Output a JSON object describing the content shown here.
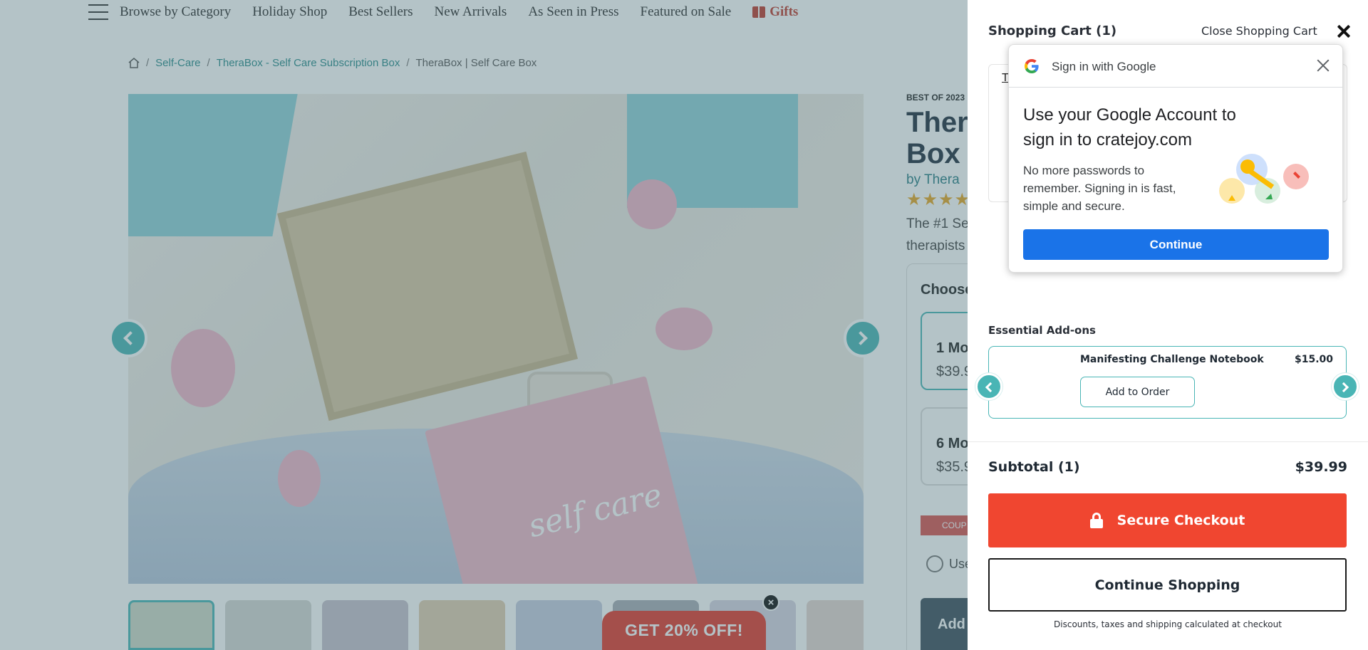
{
  "nav": {
    "items": [
      "Browse by Category",
      "Holiday Shop",
      "Best Sellers",
      "New Arrivals",
      "As Seen in Press",
      "Featured on Sale"
    ],
    "gifts": "Gifts"
  },
  "breadcrumb": {
    "items": [
      "Self-Care",
      "TheraBox - Self Care Subscription Box"
    ],
    "current": "TheraBox | Self Care Box"
  },
  "hero": {
    "book_text": "self care"
  },
  "product": {
    "badge": "BEST OF 2023",
    "title_line1": "Thera",
    "title_line2": "Box",
    "byline": "by Thera",
    "rating_stars": "★★★★★",
    "description_line1": "The #1 Se",
    "description_line2": "therapists",
    "choose_label": "Choose",
    "plans": [
      {
        "name": "1 Mo",
        "price": "$39.9"
      },
      {
        "name": "6 Mo",
        "price": "$35.9"
      }
    ],
    "coupon_label": "COUP",
    "use_label": "Use",
    "add_label": "Add"
  },
  "promo": {
    "label": "GET 20% OFF!",
    "close": "×"
  },
  "cart": {
    "title": "Shopping Cart (1)",
    "close_label": "Close Shopping Cart",
    "item_peek": "T",
    "addons_title": "Essential Add-ons",
    "addon": {
      "name": "Manifesting Challenge Notebook",
      "price": "$15.00",
      "button": "Add to Order"
    },
    "subtotal_label": "Subtotal (1)",
    "subtotal_value": "$39.99",
    "checkout_label": "Secure Checkout",
    "continue_label": "Continue Shopping",
    "footer_note": "Discounts, taxes and shipping calculated at checkout"
  },
  "google_signin": {
    "header": "Sign in with Google",
    "headline": "Use your Google Account to sign in to cratejoy.com",
    "body": "No more passwords to remember. Signing in is fast, simple and secure.",
    "continue_label": "Continue"
  },
  "colors": {
    "teal": "#49b5b5",
    "checkout_red": "#f04630",
    "google_blue": "#1a73e8",
    "promo_red": "#e4372a"
  }
}
